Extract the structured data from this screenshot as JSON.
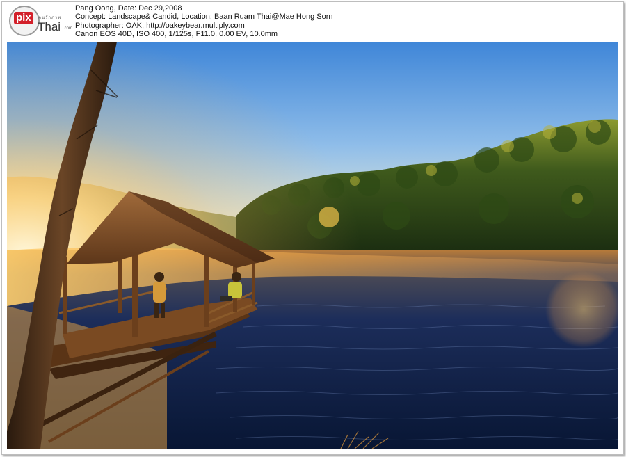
{
  "watermark": {
    "logo_pix": "pix",
    "logo_thai": "Thai",
    "logo_domain": ".com",
    "logo_tagline": "ฅนรักภาพ"
  },
  "meta": {
    "line1": "Pang Oong, Date: Dec 29,2008",
    "line2": "Concept: Landscape& Candid, Location: Baan Ruam Thai@Mae Hong Sorn",
    "line3": "Photographer: OAK, http://oakeybear.multiply.com",
    "line4": "Canon EOS 40D, ISO 400, 1/125s, F11.0, 0.00 EV, 10.0mm"
  },
  "photo": {
    "subject": "Lakeside bamboo pavilion at sunrise",
    "colors": {
      "sky_top": "#4b8fd6",
      "sky_horizon": "#f6d694",
      "forest": "#1f3b14",
      "forest_lit": "#8a9a2c",
      "water_deep": "#0d2148",
      "mist": "#f2b75a",
      "wood": "#6b3f1c"
    }
  }
}
